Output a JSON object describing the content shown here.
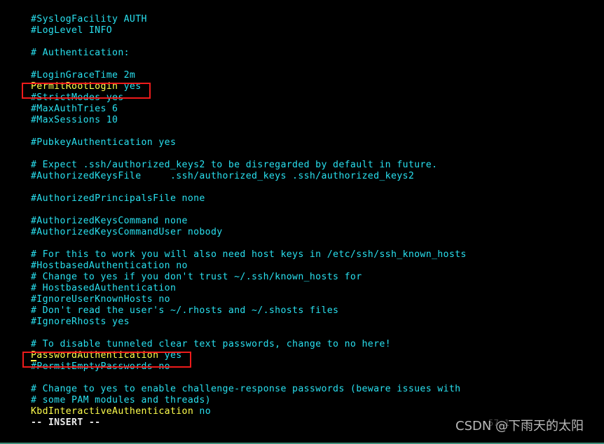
{
  "editor": {
    "mode_status": "-- INSERT --",
    "cursor_position": "57,1",
    "colors": {
      "background": "#000000",
      "comment": "#29e0ef",
      "keyword": "#ffff4d",
      "value": "#29e0ef",
      "status_text": "#e9e9e9",
      "highlight_box": "#ee1b1b",
      "bottom_border": "#3f8f7a"
    }
  },
  "watermark": {
    "text": "CSDN @下雨天的太阳"
  },
  "highlights": [
    {
      "name": "permit-root-login",
      "line_index": 6
    },
    {
      "name": "password-authentication",
      "line_index": 30
    }
  ],
  "lines": [
    {
      "text": "#SyslogFacility AUTH",
      "type": "comment"
    },
    {
      "text": "#LogLevel INFO",
      "type": "comment"
    },
    {
      "text": "",
      "type": "blank"
    },
    {
      "text": "# Authentication:",
      "type": "comment"
    },
    {
      "text": "",
      "type": "blank"
    },
    {
      "text": "#LoginGraceTime 2m",
      "type": "comment"
    },
    {
      "text": "PermitRootLogin yes",
      "type": "directive",
      "key": "PermitRootLogin",
      "value": "yes"
    },
    {
      "text": "#StrictModes yes",
      "type": "comment"
    },
    {
      "text": "#MaxAuthTries 6",
      "type": "comment"
    },
    {
      "text": "#MaxSessions 10",
      "type": "comment"
    },
    {
      "text": "",
      "type": "blank"
    },
    {
      "text": "#PubkeyAuthentication yes",
      "type": "comment"
    },
    {
      "text": "",
      "type": "blank"
    },
    {
      "text": "# Expect .ssh/authorized_keys2 to be disregarded by default in future.",
      "type": "comment"
    },
    {
      "text": "#AuthorizedKeysFile     .ssh/authorized_keys .ssh/authorized_keys2",
      "type": "comment"
    },
    {
      "text": "",
      "type": "blank"
    },
    {
      "text": "#AuthorizedPrincipalsFile none",
      "type": "comment"
    },
    {
      "text": "",
      "type": "blank"
    },
    {
      "text": "#AuthorizedKeysCommand none",
      "type": "comment"
    },
    {
      "text": "#AuthorizedKeysCommandUser nobody",
      "type": "comment"
    },
    {
      "text": "",
      "type": "blank"
    },
    {
      "text": "# For this to work you will also need host keys in /etc/ssh/ssh_known_hosts",
      "type": "comment"
    },
    {
      "text": "#HostbasedAuthentication no",
      "type": "comment"
    },
    {
      "text": "# Change to yes if you don't trust ~/.ssh/known_hosts for",
      "type": "comment"
    },
    {
      "text": "# HostbasedAuthentication",
      "type": "comment"
    },
    {
      "text": "#IgnoreUserKnownHosts no",
      "type": "comment"
    },
    {
      "text": "# Don't read the user's ~/.rhosts and ~/.shosts files",
      "type": "comment"
    },
    {
      "text": "#IgnoreRhosts yes",
      "type": "comment"
    },
    {
      "text": "",
      "type": "blank"
    },
    {
      "text": "# To disable tunneled clear text passwords, change to no here!",
      "type": "comment"
    },
    {
      "text": "PasswordAuthentication yes",
      "type": "directive-cursor",
      "key": "PasswordAuthentication",
      "value": "yes",
      "cursor_char": "P"
    },
    {
      "text": "#PermitEmptyPasswords no",
      "type": "comment"
    },
    {
      "text": "",
      "type": "blank"
    },
    {
      "text": "# Change to yes to enable challenge-response passwords (beware issues with",
      "type": "comment"
    },
    {
      "text": "# some PAM modules and threads)",
      "type": "comment"
    },
    {
      "text": "KbdInteractiveAuthentication no",
      "type": "directive",
      "key": "KbdInteractiveAuthentication",
      "value": "no"
    }
  ]
}
